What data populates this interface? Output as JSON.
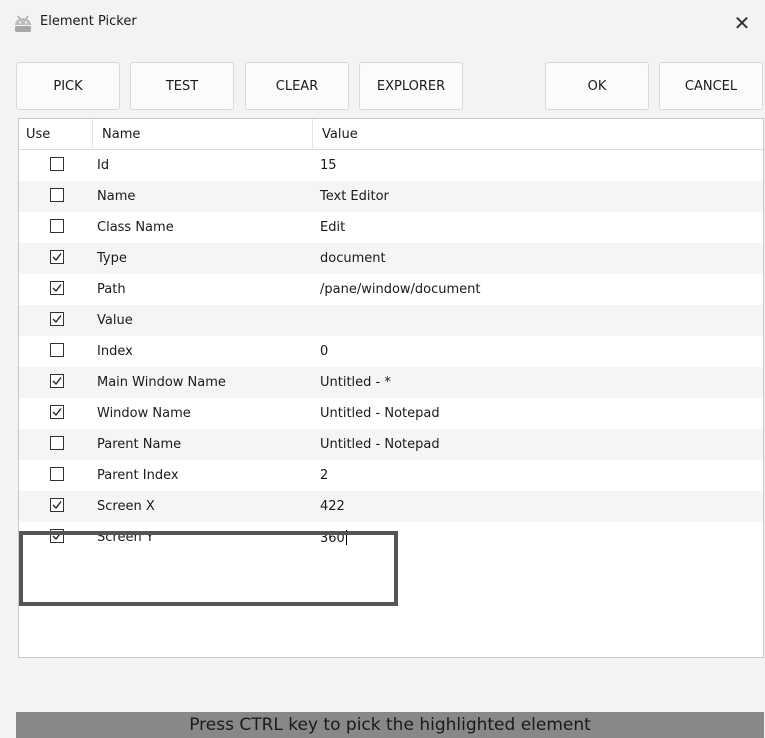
{
  "window": {
    "title": "Element Picker",
    "icon": "android-robot-icon",
    "close_glyph": "✕"
  },
  "toolbar": {
    "pick_label": "PICK",
    "test_label": "TEST",
    "clear_label": "CLEAR",
    "explorer_label": "EXPLORER",
    "ok_label": "OK",
    "cancel_label": "CANCEL"
  },
  "grid": {
    "columns": [
      "Use",
      "Name",
      "Value"
    ],
    "rows": [
      {
        "checked": false,
        "name": "Id",
        "value": "15"
      },
      {
        "checked": false,
        "name": "Name",
        "value": "Text Editor"
      },
      {
        "checked": false,
        "name": "Class Name",
        "value": "Edit"
      },
      {
        "checked": true,
        "name": "Type",
        "value": "document"
      },
      {
        "checked": true,
        "name": "Path",
        "value": "/pane/window/document"
      },
      {
        "checked": true,
        "name": "Value",
        "value": ""
      },
      {
        "checked": false,
        "name": "Index",
        "value": "0"
      },
      {
        "checked": true,
        "name": "Main Window Name",
        "value": "Untitled - *"
      },
      {
        "checked": true,
        "name": "Window Name",
        "value": "Untitled - Notepad"
      },
      {
        "checked": false,
        "name": "Parent Name",
        "value": "Untitled - Notepad"
      },
      {
        "checked": false,
        "name": "Parent Index",
        "value": "2"
      },
      {
        "checked": true,
        "name": "Screen X",
        "value": "422"
      },
      {
        "checked": true,
        "name": "Screen Y",
        "value": "360"
      }
    ]
  },
  "status": {
    "text": "Press CTRL key to pick the highlighted element"
  },
  "colors": {
    "status_bar": "#888888",
    "highlight_border": "#555555"
  }
}
